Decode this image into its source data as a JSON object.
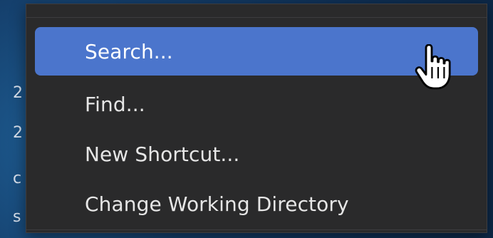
{
  "menu": {
    "items": [
      {
        "label": "Search...",
        "highlighted": true
      },
      {
        "label": "Find...",
        "highlighted": false
      },
      {
        "label": "New Shortcut...",
        "highlighted": false
      },
      {
        "label": "Change Working Directory",
        "highlighted": false
      }
    ]
  },
  "background_strip": {
    "fragments": [
      "2",
      "2",
      "c",
      "s"
    ]
  },
  "colors": {
    "highlight": "#4b75cc",
    "menu_background": "#2a2a2b",
    "menu_text": "#e6e6e6",
    "desktop_background": "#123a63"
  },
  "cursor": {
    "icon": "hand-pointer-icon"
  }
}
